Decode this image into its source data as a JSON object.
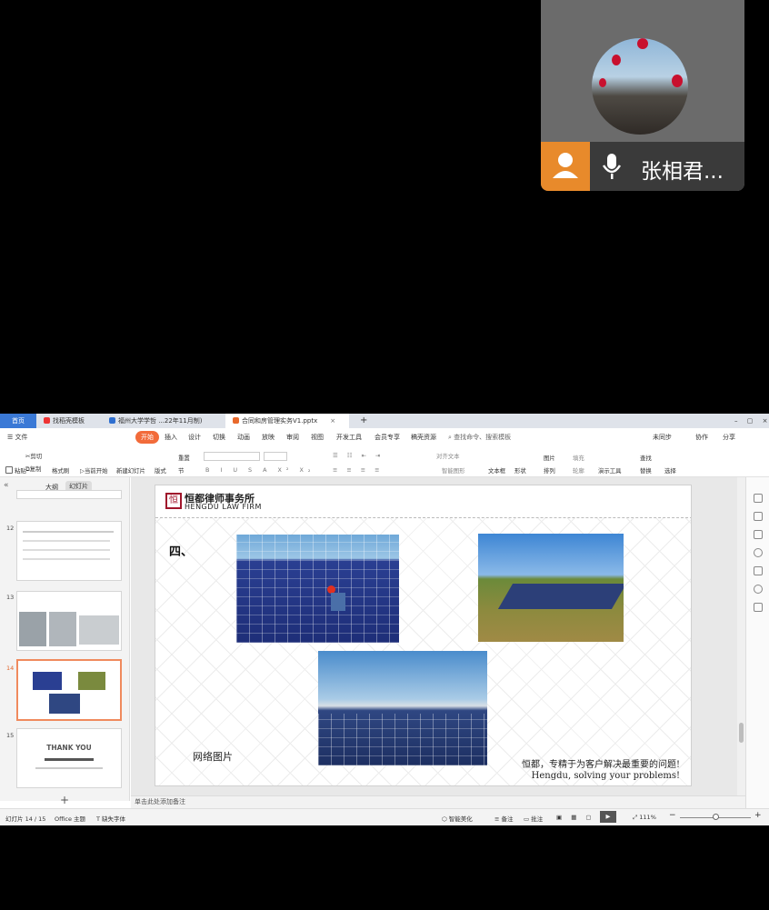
{
  "meeting": {
    "participant_name": "张相君..."
  },
  "tabs": [
    {
      "label": "首页"
    },
    {
      "label": "找稻壳模板"
    },
    {
      "label": "福州大学学哲 ...22年11月制)"
    },
    {
      "label": "合同和房管理实务V1.pptx"
    }
  ],
  "menu": {
    "items": [
      "文件",
      "开始",
      "插入",
      "设计",
      "切换",
      "动画",
      "放映",
      "审阅",
      "视图",
      "开发工具",
      "会员专享",
      "稿壳资源"
    ],
    "search": "查找命令、搜索模板",
    "sync": "未同步",
    "collab": "协作",
    "share": "分享"
  },
  "ribbon": {
    "labels": [
      "粘贴",
      "剪切",
      "复制",
      "格式刷",
      "当前开始",
      "新建幻灯片",
      "版式",
      "节",
      "重置",
      "对齐文本",
      "智能图形",
      "文本框",
      "形状",
      "图片",
      "排列",
      "填充",
      "轮廓",
      "演示工具",
      "查找",
      "替换",
      "选择"
    ]
  },
  "sidebar": {
    "outline_tab": "大纲",
    "slides_tab": "幻灯片",
    "thumbs": [
      {
        "num": "12"
      },
      {
        "num": "13"
      },
      {
        "num": "14"
      },
      {
        "num": "15",
        "title": "THANK YOU"
      }
    ],
    "add": "+"
  },
  "slide": {
    "firm_cn": "恒都律师事务所",
    "firm_en": "HENGDU LAW FIRM",
    "section": "四、",
    "caption": "网络图片",
    "slogan_cn": "恒都，专精于为客户解决最重要的问题!",
    "slogan_en": "Hengdu, solving your problems!"
  },
  "notes": {
    "placeholder": "单击此处添加备注"
  },
  "status": {
    "slide_info": "幻灯片 14 / 15",
    "theme": "Office 主题",
    "font_missing": "缺失字体",
    "beautify": "智能美化",
    "notes": "备注",
    "comments": "批注",
    "zoom": "111%"
  }
}
